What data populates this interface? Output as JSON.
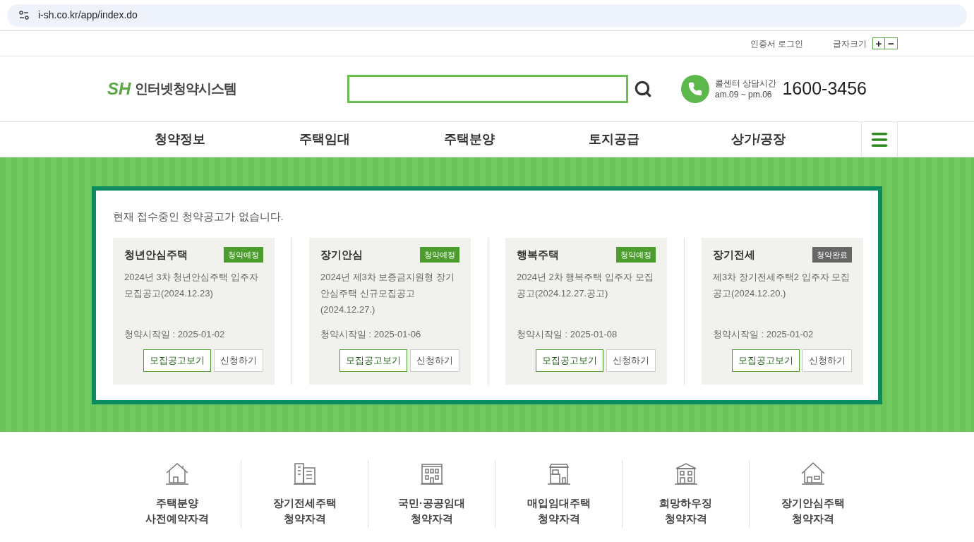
{
  "browser": {
    "url": "i-sh.co.kr/app/index.do"
  },
  "utility_bar": {
    "cert_login": "인증서 로그인",
    "font_size_label": "글자크기",
    "font_plus": "+",
    "font_minus": "−"
  },
  "header": {
    "logo_mark": "SH",
    "logo_text": "인터넷청약시스템",
    "call_center": {
      "label": "콜센터 상담시간",
      "hours": "am.09 ~ pm.06",
      "phone": "1600-3456"
    }
  },
  "nav": {
    "items": [
      "청약정보",
      "주택임대",
      "주택분양",
      "토지공급",
      "상가/공장"
    ]
  },
  "notice": {
    "message": "현재 접수중인 청약공고가 없습니다.",
    "cards": [
      {
        "title": "청년안심주택",
        "status": {
          "kind": "upcoming",
          "label": "청약예정"
        },
        "description": "2024년 3차 청년안심주택 입주자 모집공고(2024.12.23)",
        "start_date": "청약시작일 : 2025-01-02",
        "buttons": [
          "모집공고보기",
          "신청하기"
        ]
      },
      {
        "title": "장기안심",
        "status": {
          "kind": "upcoming",
          "label": "청약예정"
        },
        "description": "2024년 제3차 보증금지원형 장기안심주택 신규모집공고(2024.12.27.)",
        "start_date": "청약시작일 : 2025-01-06",
        "buttons": [
          "모집공고보기",
          "신청하기"
        ]
      },
      {
        "title": "행복주택",
        "status": {
          "kind": "upcoming",
          "label": "청약예정"
        },
        "description": "2024년 2차 행복주택 입주자 모집 공고(2024.12.27.공고)",
        "start_date": "청약시작일 : 2025-01-08",
        "buttons": [
          "모집공고보기",
          "신청하기"
        ]
      },
      {
        "title": "장기전세",
        "status": {
          "kind": "closed",
          "label": "청약완료"
        },
        "description": "제3차 장기전세주택2 입주자 모집 공고(2024.12.20.)",
        "start_date": "청약시작일 : 2025-01-02",
        "buttons": [
          "모집공고보기",
          "신청하기"
        ]
      }
    ]
  },
  "quick_links": [
    {
      "kind": "house",
      "line1": "주택분양",
      "line2": "사전예약자격"
    },
    {
      "kind": "tower",
      "line1": "장기전세주택",
      "line2": "청약자격"
    },
    {
      "kind": "apartment",
      "line1": "국민·공공임대",
      "line2": "청약자격"
    },
    {
      "kind": "shop",
      "line1": "매입임대주택",
      "line2": "청약자격"
    },
    {
      "kind": "building",
      "line1": "희망하우징",
      "line2": "청약자격"
    },
    {
      "kind": "cottage",
      "line1": "장기안심주택",
      "line2": "청약자격"
    }
  ]
}
